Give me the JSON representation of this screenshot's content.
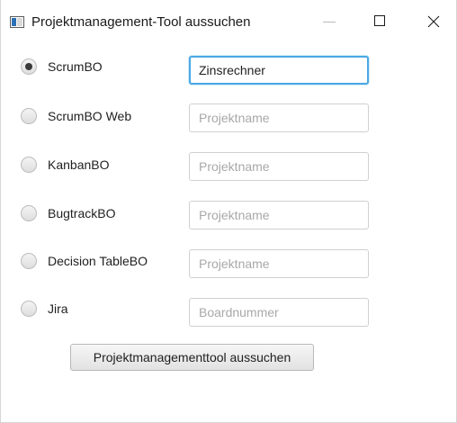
{
  "window": {
    "title": "Projektmanagement-Tool aussuchen",
    "controls": {
      "minimize_icon": "minimize-icon",
      "maximize_icon": "maximize-icon",
      "close_icon": "close-icon"
    }
  },
  "options": [
    {
      "label": "ScrumBO",
      "checked": true,
      "input_value": "Zinsrechner",
      "input_placeholder": "",
      "focused": true
    },
    {
      "label": "ScrumBO Web",
      "checked": false,
      "input_value": "",
      "input_placeholder": "Projektname"
    },
    {
      "label": "KanbanBO",
      "checked": false,
      "input_value": "",
      "input_placeholder": "Projektname"
    },
    {
      "label": "BugtrackBO",
      "checked": false,
      "input_value": "",
      "input_placeholder": "Projektname"
    },
    {
      "label": "Decision TableBO",
      "checked": false,
      "input_value": "",
      "input_placeholder": "Projektname"
    },
    {
      "label": "Jira",
      "checked": false,
      "input_value": "",
      "input_placeholder": "Boardnummer"
    }
  ],
  "submit_label": "Projektmanagementtool aussuchen",
  "colors": {
    "focus_border": "#4aa8e4",
    "app_icon_accent": "#2b6fb5"
  }
}
